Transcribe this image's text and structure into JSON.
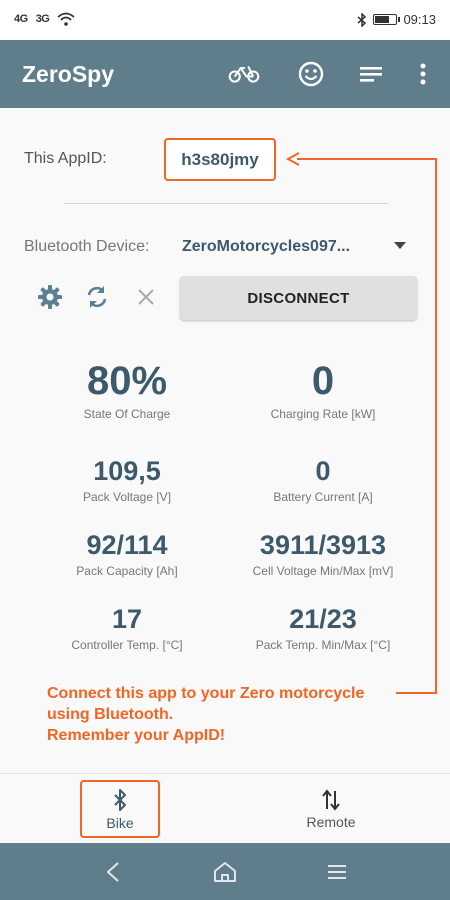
{
  "status_bar": {
    "signal_1": "4G",
    "signal_2": "3G",
    "time": "09:13"
  },
  "app": {
    "title": "ZeroSpy"
  },
  "toolbar": {
    "icons": [
      "bike-icon",
      "smiley-icon",
      "menu-lines-icon",
      "overflow-menu-icon"
    ]
  },
  "app_id": {
    "label": "This AppID:",
    "value": "h3s80jmy"
  },
  "bluetooth": {
    "label": "Bluetooth Device:",
    "device": "ZeroMotorcycles097..."
  },
  "controls": {
    "disconnect_label": "DISCONNECT"
  },
  "metrics": [
    {
      "value": "80%",
      "label": "State Of Charge"
    },
    {
      "value": "0",
      "label": "Charging Rate [kW]"
    },
    {
      "value": "109,5",
      "label": "Pack Voltage [V]"
    },
    {
      "value": "0",
      "label": "Battery Current [A]"
    },
    {
      "value": "92/114",
      "label": "Pack Capacity [Ah]"
    },
    {
      "value": "3911/3913",
      "label": "Cell Voltage Min/Max [mV]"
    },
    {
      "value": "17",
      "label": "Controller Temp. [°C]"
    },
    {
      "value": "21/23",
      "label": "Pack Temp. Min/Max [°C]"
    }
  ],
  "annotation": {
    "line1": "Connect this app to your Zero motorcycle",
    "line2": "using Bluetooth.",
    "line3": "Remember your AppID!"
  },
  "tabs": [
    {
      "label": "Bike",
      "icon": "bluetooth-icon",
      "active": true
    },
    {
      "label": "Remote",
      "icon": "swap-arrows-icon",
      "active": false
    }
  ],
  "colors": {
    "primary": "#607d8b",
    "accent": "#f26522",
    "value_text": "#3d5a6c"
  }
}
